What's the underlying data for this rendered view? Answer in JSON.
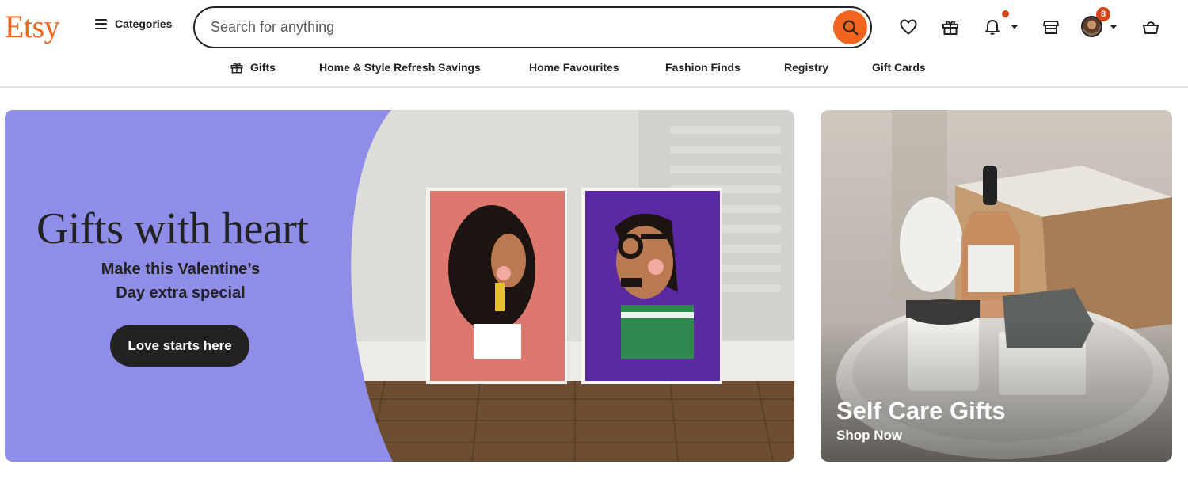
{
  "header": {
    "logo": "Etsy",
    "categories_label": "Categories",
    "search_placeholder": "Search for anything",
    "notification_dot": true,
    "account_badge_count": "8"
  },
  "subnav": {
    "items": [
      {
        "label": "Gifts",
        "icon": "gift-icon"
      },
      {
        "label": "Home & Style Refresh Savings"
      },
      {
        "label": "Home Favourites"
      },
      {
        "label": "Fashion Finds"
      },
      {
        "label": "Registry"
      },
      {
        "label": "Gift Cards"
      }
    ]
  },
  "hero": {
    "title": "Gifts with heart",
    "subtitle_line1": "Make this Valentine’s",
    "subtitle_line2": "Day extra special",
    "cta_label": "Love starts here",
    "background_color": "#8e8de8"
  },
  "promo": {
    "title": "Self Care Gifts",
    "subtitle": "Shop Now"
  },
  "colors": {
    "brand": "#f1641e",
    "text": "#222222",
    "hero_purple": "#8e8de8",
    "badge": "#d5451b"
  }
}
